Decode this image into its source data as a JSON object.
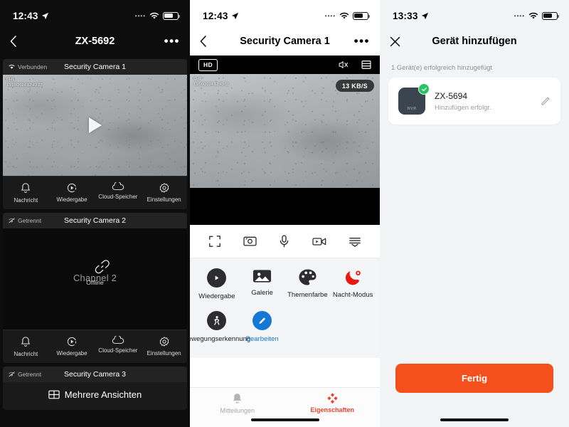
{
  "panel1": {
    "status": {
      "time": "12:43",
      "location_icon": "location-arrow-icon",
      "signal_icon": "signal-dots-icon",
      "wifi_icon": "wifi-icon",
      "battery_icon": "battery-icon"
    },
    "nav": {
      "back_icon": "chevron-left-icon",
      "title": "ZX-5692",
      "more_icon": "ellipsis-icon"
    },
    "cameras": [
      {
        "status_label": "Verbunden",
        "status_icon": "connected-icon",
        "name": "Security Camera 1",
        "state": "live",
        "osd_channel": "CH1",
        "osd_timestamp": "13/09/2024 12:43:27",
        "play_icon": "play-triangle-icon"
      },
      {
        "status_label": "Getrennt",
        "status_icon": "disconnected-icon",
        "name": "Security Camera 2",
        "state": "offline",
        "offline_title": "Channel 2",
        "offline_sub": "Offline",
        "offline_icon": "broken-link-icon"
      }
    ],
    "tools": [
      {
        "label": "Nachricht",
        "icon": "bell-icon"
      },
      {
        "label": "Wiedergabe",
        "icon": "playback-icon"
      },
      {
        "label": "Cloud-Speicher",
        "icon": "cloud-icon"
      },
      {
        "label": "Einstellungen",
        "icon": "gear-icon"
      }
    ],
    "camera3": {
      "status_label": "Getrennt",
      "status_icon": "disconnected-icon",
      "name": "Security Camera 3"
    },
    "multi_view": {
      "label": "Mehrere Ansichten",
      "icon": "grid-icon"
    }
  },
  "panel2": {
    "status": {
      "time": "12:43"
    },
    "nav": {
      "back_icon": "chevron-left-icon",
      "title": "Security Camera 1",
      "more_icon": "ellipsis-icon"
    },
    "video": {
      "quality_badge": "HD",
      "mute_icon": "speaker-muted-icon",
      "layers_icon": "stream-list-icon",
      "osd_channel": "CH1",
      "osd_timestamp": "13/09/2024 12:43:11",
      "bitrate_badge": "13 KB/S"
    },
    "control_icons": [
      {
        "name": "fullscreen-icon"
      },
      {
        "name": "snapshot-icon"
      },
      {
        "name": "microphone-icon"
      },
      {
        "name": "record-video-icon"
      },
      {
        "name": "more-options-icon"
      }
    ],
    "features": [
      {
        "label": "Wiedergabe",
        "icon": "playback-circle-icon",
        "style": "dark"
      },
      {
        "label": "Galerie",
        "icon": "gallery-icon",
        "style": "plain"
      },
      {
        "label": "Themenfarbe",
        "icon": "palette-icon",
        "style": "plain"
      },
      {
        "label": "Nacht-Modus",
        "icon": "night-mode-icon",
        "style": "red"
      },
      {
        "label": "Bewegungserkennung",
        "icon": "motion-detection-icon",
        "style": "dark"
      },
      {
        "label": "Bearbeiten",
        "icon": "edit-pencil-icon",
        "style": "blue"
      }
    ],
    "tabs": [
      {
        "label": "Mitteilungen",
        "icon": "bell-icon",
        "active": false
      },
      {
        "label": "Eigenschaften",
        "icon": "diamond-cluster-icon",
        "active": true
      }
    ]
  },
  "panel3": {
    "status": {
      "time": "13:33"
    },
    "nav": {
      "close_icon": "close-x-icon",
      "title": "Gerät hinzufügen"
    },
    "subtitle": "1 Gerät(e) erfolgreich hinzugefügt",
    "device": {
      "icon": "nvr-device-icon",
      "icon_label": "NVR",
      "badge_icon": "check-circle-icon",
      "name": "ZX-5694",
      "status": "Hinzufügen erfolgr.",
      "edit_icon": "pencil-icon"
    },
    "primary_button": "Fertig"
  },
  "colors": {
    "accent_orange": "#f4501e",
    "accent_red": "#e8442a",
    "accent_blue": "#1478d4",
    "success_green": "#27c462",
    "dark_bg": "#0d0d0d",
    "card_bg": "#1a1a1a"
  }
}
